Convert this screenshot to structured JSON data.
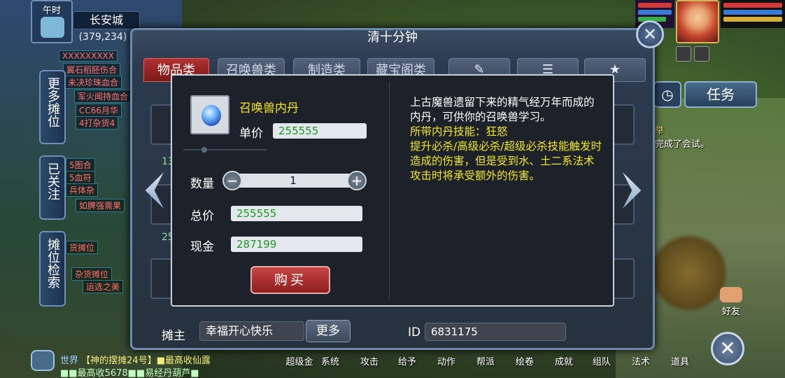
{
  "hud": {
    "time_label": "午时",
    "city": "长安城",
    "coords": "(379,234)"
  },
  "side_tabs": [
    {
      "label": "更多摊位"
    },
    {
      "label": "已关注"
    },
    {
      "label": "摊位检索"
    }
  ],
  "stream_tags": [
    "XXXXXXXXX",
    "翼石稻胚伤合",
    "未决珍珠血合",
    "军火闻持血合",
    "CC66月华",
    "4打杂货4",
    "5图合",
    "5血符",
    "兵体杂",
    "如脾强需果",
    "货摊位",
    "杂货摊位",
    "运选之美"
  ],
  "dialog": {
    "title": "清十分钟",
    "tabs": [
      {
        "label": "物品类",
        "active": true
      },
      {
        "label": "召唤兽类",
        "active": false
      },
      {
        "label": "制造类",
        "active": false
      },
      {
        "label": "藏宝阁类",
        "active": false
      }
    ],
    "owner_label": "摊主",
    "owner_name": "幸福开心快乐",
    "more_label": "更多",
    "id_label": "ID",
    "id_value": "6831175",
    "background_prices": [
      "13",
      "25"
    ]
  },
  "popup": {
    "item_name": "召唤兽内丹",
    "price_label": "单价",
    "price_value": "255555",
    "quantity_label": "数量",
    "quantity_value": "1",
    "minus_label": "−",
    "plus_label": "+",
    "total_label": "总价",
    "total_value": "255555",
    "cash_label": "现金",
    "cash_value": "287199",
    "buy_label": "购买",
    "description": "上古魔兽遗留下来的精气经万年而成的内丹，可供你的召唤兽学习。",
    "skill_heading": "所带内丹技能：狂怒",
    "skill_text": "提升必杀/高级必杀/超级必杀技能触发时造成的伤害，但是受到水、土二系法术攻击时将承受额外的伤害。"
  },
  "right_hud": {
    "task_label": "任务",
    "chat_line1": "举",
    "chat_line2": "完成了会试。",
    "friends_label": "好友"
  },
  "bottom": {
    "world_chat_channel": "世界",
    "world_chat_line1": "【神的摆摊24号】■最高收仙露",
    "world_chat_line2": "■■最高收5678■■易经丹葫芦■",
    "menu": [
      "超级金",
      "系统",
      "攻击",
      "给予",
      "动作",
      "帮派",
      "绘卷",
      "成就",
      "组队",
      "法术",
      "道具"
    ]
  },
  "colors": {
    "active_tab": "#b33030",
    "item_name": "#f5e81e",
    "value_green": "#1a9a1a",
    "buy_button": "#c74545"
  }
}
